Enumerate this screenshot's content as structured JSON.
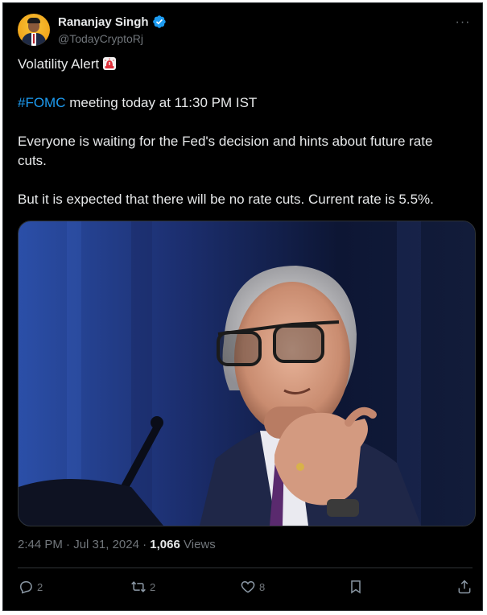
{
  "author": {
    "display_name": "Rananjay Singh",
    "handle": "@TodayCryptoRj",
    "verified_icon": "verified-badge-icon",
    "avatar_colors": {
      "background": "#f1a51a"
    }
  },
  "tweet": {
    "line1": "Volatility Alert",
    "line1_emoji": "police-light-siren-icon",
    "hashtag": "#FOMC",
    "line2_rest": " meeting today at 11:30 PM IST",
    "line3": "Everyone is waiting for the Fed's decision and hints about future rate cuts.",
    "line4": "But it is expected that there will be no rate cuts. Current rate is 5.5%."
  },
  "media": {
    "description_icon": "photo-of-man-with-glasses-speaking-icon"
  },
  "meta": {
    "time": "2:44 PM",
    "separator": "·",
    "date": "Jul 31, 2024",
    "views_count": "1,066",
    "views_label": "Views"
  },
  "actions": {
    "reply_count": "2",
    "retweet_count": "2",
    "like_count": "8"
  },
  "colors": {
    "background": "#000000",
    "text": "#e7e9ea",
    "muted": "#71767b",
    "accent": "#1d9bf0",
    "border": "#2f3336"
  }
}
